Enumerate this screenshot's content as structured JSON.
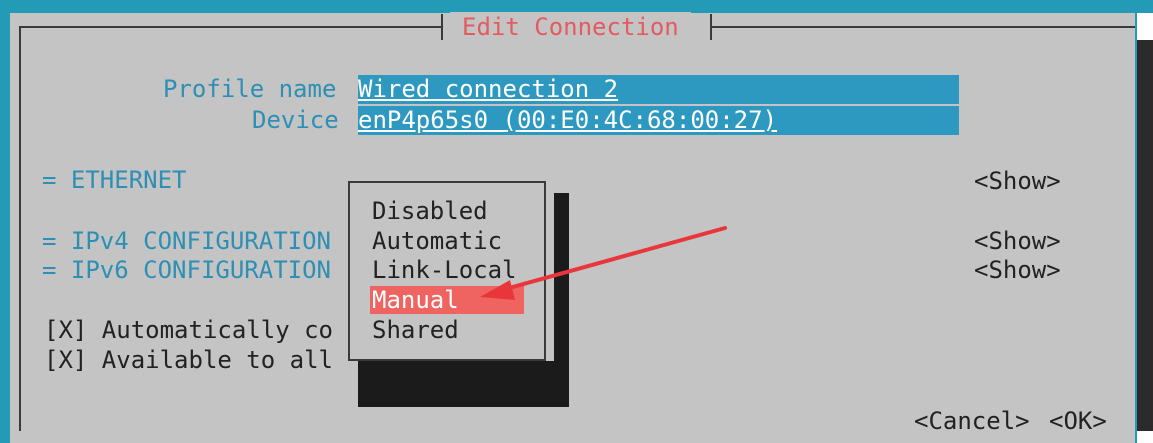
{
  "dialog": {
    "title": "Edit Connection"
  },
  "profile": {
    "name_label": "Profile name",
    "name_value": "Wired connection 2",
    "device_label": "Device",
    "device_value": "enP4p65s0 (00:E0:4C:68:00:27)"
  },
  "sections": [
    {
      "label": "= ETHERNET",
      "action": "<Show>"
    },
    {
      "label": "= IPv4 CONFIGURATION",
      "action": "<Show>"
    },
    {
      "label": "= IPv6 CONFIGURATION",
      "action": "<Show>"
    }
  ],
  "checkboxes": [
    {
      "text": "[X] Automatically co"
    },
    {
      "text": "[X] Available to all"
    }
  ],
  "dropdown": {
    "options": [
      "Disabled",
      "Automatic",
      "Link-Local",
      "Manual",
      "Shared"
    ],
    "selected": "Manual"
  },
  "buttons": {
    "cancel": "<Cancel>",
    "ok": "<OK>"
  },
  "colors": {
    "terminal_bg": "#239ab6",
    "dialog_bg": "#c4c4c4",
    "field_bg": "#2e99c0",
    "title_text": "#e45a61",
    "highlight": "#ef6461",
    "annotation_arrow": "#e8363b"
  }
}
